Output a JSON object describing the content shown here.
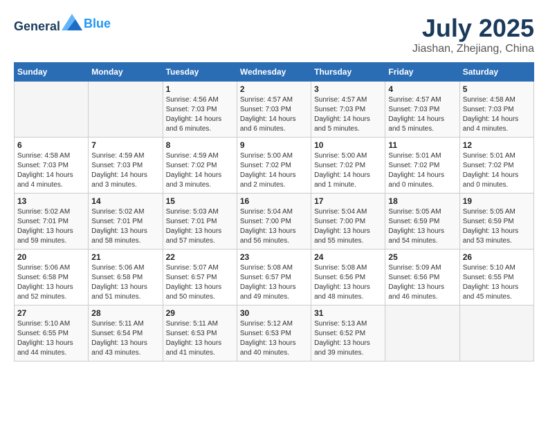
{
  "app": {
    "name_general": "General",
    "name_blue": "Blue"
  },
  "title": {
    "month": "July 2025",
    "location": "Jiashan, Zhejiang, China"
  },
  "weekdays": [
    "Sunday",
    "Monday",
    "Tuesday",
    "Wednesday",
    "Thursday",
    "Friday",
    "Saturday"
  ],
  "weeks": [
    [
      {
        "day": "",
        "sunrise": "",
        "sunset": "",
        "daylight": ""
      },
      {
        "day": "",
        "sunrise": "",
        "sunset": "",
        "daylight": ""
      },
      {
        "day": "1",
        "sunrise": "Sunrise: 4:56 AM",
        "sunset": "Sunset: 7:03 PM",
        "daylight": "Daylight: 14 hours and 6 minutes."
      },
      {
        "day": "2",
        "sunrise": "Sunrise: 4:57 AM",
        "sunset": "Sunset: 7:03 PM",
        "daylight": "Daylight: 14 hours and 6 minutes."
      },
      {
        "day": "3",
        "sunrise": "Sunrise: 4:57 AM",
        "sunset": "Sunset: 7:03 PM",
        "daylight": "Daylight: 14 hours and 5 minutes."
      },
      {
        "day": "4",
        "sunrise": "Sunrise: 4:57 AM",
        "sunset": "Sunset: 7:03 PM",
        "daylight": "Daylight: 14 hours and 5 minutes."
      },
      {
        "day": "5",
        "sunrise": "Sunrise: 4:58 AM",
        "sunset": "Sunset: 7:03 PM",
        "daylight": "Daylight: 14 hours and 4 minutes."
      }
    ],
    [
      {
        "day": "6",
        "sunrise": "Sunrise: 4:58 AM",
        "sunset": "Sunset: 7:03 PM",
        "daylight": "Daylight: 14 hours and 4 minutes."
      },
      {
        "day": "7",
        "sunrise": "Sunrise: 4:59 AM",
        "sunset": "Sunset: 7:03 PM",
        "daylight": "Daylight: 14 hours and 3 minutes."
      },
      {
        "day": "8",
        "sunrise": "Sunrise: 4:59 AM",
        "sunset": "Sunset: 7:02 PM",
        "daylight": "Daylight: 14 hours and 3 minutes."
      },
      {
        "day": "9",
        "sunrise": "Sunrise: 5:00 AM",
        "sunset": "Sunset: 7:02 PM",
        "daylight": "Daylight: 14 hours and 2 minutes."
      },
      {
        "day": "10",
        "sunrise": "Sunrise: 5:00 AM",
        "sunset": "Sunset: 7:02 PM",
        "daylight": "Daylight: 14 hours and 1 minute."
      },
      {
        "day": "11",
        "sunrise": "Sunrise: 5:01 AM",
        "sunset": "Sunset: 7:02 PM",
        "daylight": "Daylight: 14 hours and 0 minutes."
      },
      {
        "day": "12",
        "sunrise": "Sunrise: 5:01 AM",
        "sunset": "Sunset: 7:02 PM",
        "daylight": "Daylight: 14 hours and 0 minutes."
      }
    ],
    [
      {
        "day": "13",
        "sunrise": "Sunrise: 5:02 AM",
        "sunset": "Sunset: 7:01 PM",
        "daylight": "Daylight: 13 hours and 59 minutes."
      },
      {
        "day": "14",
        "sunrise": "Sunrise: 5:02 AM",
        "sunset": "Sunset: 7:01 PM",
        "daylight": "Daylight: 13 hours and 58 minutes."
      },
      {
        "day": "15",
        "sunrise": "Sunrise: 5:03 AM",
        "sunset": "Sunset: 7:01 PM",
        "daylight": "Daylight: 13 hours and 57 minutes."
      },
      {
        "day": "16",
        "sunrise": "Sunrise: 5:04 AM",
        "sunset": "Sunset: 7:00 PM",
        "daylight": "Daylight: 13 hours and 56 minutes."
      },
      {
        "day": "17",
        "sunrise": "Sunrise: 5:04 AM",
        "sunset": "Sunset: 7:00 PM",
        "daylight": "Daylight: 13 hours and 55 minutes."
      },
      {
        "day": "18",
        "sunrise": "Sunrise: 5:05 AM",
        "sunset": "Sunset: 6:59 PM",
        "daylight": "Daylight: 13 hours and 54 minutes."
      },
      {
        "day": "19",
        "sunrise": "Sunrise: 5:05 AM",
        "sunset": "Sunset: 6:59 PM",
        "daylight": "Daylight: 13 hours and 53 minutes."
      }
    ],
    [
      {
        "day": "20",
        "sunrise": "Sunrise: 5:06 AM",
        "sunset": "Sunset: 6:58 PM",
        "daylight": "Daylight: 13 hours and 52 minutes."
      },
      {
        "day": "21",
        "sunrise": "Sunrise: 5:06 AM",
        "sunset": "Sunset: 6:58 PM",
        "daylight": "Daylight: 13 hours and 51 minutes."
      },
      {
        "day": "22",
        "sunrise": "Sunrise: 5:07 AM",
        "sunset": "Sunset: 6:57 PM",
        "daylight": "Daylight: 13 hours and 50 minutes."
      },
      {
        "day": "23",
        "sunrise": "Sunrise: 5:08 AM",
        "sunset": "Sunset: 6:57 PM",
        "daylight": "Daylight: 13 hours and 49 minutes."
      },
      {
        "day": "24",
        "sunrise": "Sunrise: 5:08 AM",
        "sunset": "Sunset: 6:56 PM",
        "daylight": "Daylight: 13 hours and 48 minutes."
      },
      {
        "day": "25",
        "sunrise": "Sunrise: 5:09 AM",
        "sunset": "Sunset: 6:56 PM",
        "daylight": "Daylight: 13 hours and 46 minutes."
      },
      {
        "day": "26",
        "sunrise": "Sunrise: 5:10 AM",
        "sunset": "Sunset: 6:55 PM",
        "daylight": "Daylight: 13 hours and 45 minutes."
      }
    ],
    [
      {
        "day": "27",
        "sunrise": "Sunrise: 5:10 AM",
        "sunset": "Sunset: 6:55 PM",
        "daylight": "Daylight: 13 hours and 44 minutes."
      },
      {
        "day": "28",
        "sunrise": "Sunrise: 5:11 AM",
        "sunset": "Sunset: 6:54 PM",
        "daylight": "Daylight: 13 hours and 43 minutes."
      },
      {
        "day": "29",
        "sunrise": "Sunrise: 5:11 AM",
        "sunset": "Sunset: 6:53 PM",
        "daylight": "Daylight: 13 hours and 41 minutes."
      },
      {
        "day": "30",
        "sunrise": "Sunrise: 5:12 AM",
        "sunset": "Sunset: 6:53 PM",
        "daylight": "Daylight: 13 hours and 40 minutes."
      },
      {
        "day": "31",
        "sunrise": "Sunrise: 5:13 AM",
        "sunset": "Sunset: 6:52 PM",
        "daylight": "Daylight: 13 hours and 39 minutes."
      },
      {
        "day": "",
        "sunrise": "",
        "sunset": "",
        "daylight": ""
      },
      {
        "day": "",
        "sunrise": "",
        "sunset": "",
        "daylight": ""
      }
    ]
  ]
}
